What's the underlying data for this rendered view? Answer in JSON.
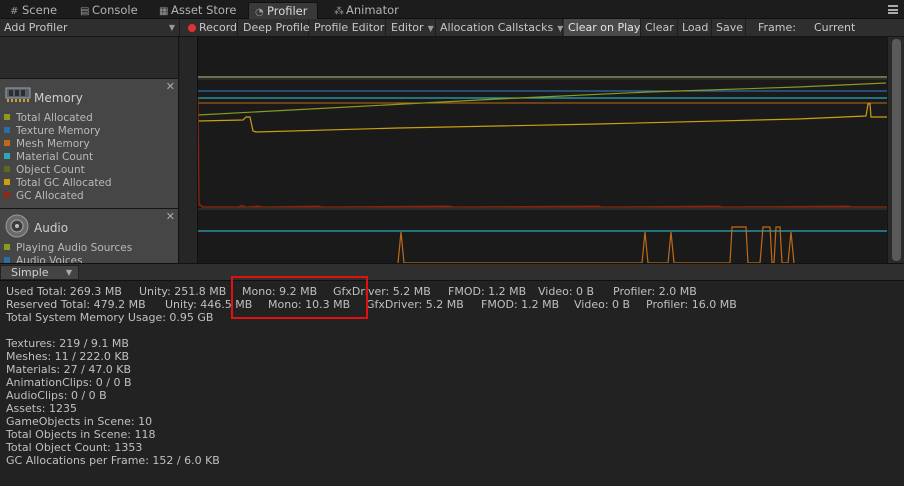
{
  "tabs": [
    {
      "label": "Scene",
      "icon": "grid-icon",
      "active": false
    },
    {
      "label": "Console",
      "icon": "console-icon",
      "active": false
    },
    {
      "label": "Asset Store",
      "icon": "store-icon",
      "active": false
    },
    {
      "label": "Profiler",
      "icon": "profiler-icon",
      "active": true
    },
    {
      "label": "Animator",
      "icon": "animator-icon",
      "active": false
    }
  ],
  "toolbar": {
    "add_profiler": "Add Profiler",
    "record": "Record",
    "deep_profile": "Deep Profile",
    "profile_editor": "Profile Editor",
    "editor": "Editor",
    "allocation_callstacks": "Allocation Callstacks",
    "clear_on_play": "Clear on Play",
    "clear": "Clear",
    "load": "Load",
    "save": "Save",
    "frame_label": "Frame:",
    "frame_value": "Current"
  },
  "memory_module": {
    "title": "Memory",
    "legend": [
      {
        "label": "Total Allocated",
        "color": "#8a9a1c"
      },
      {
        "label": "Texture Memory",
        "color": "#2c6fa6"
      },
      {
        "label": "Mesh Memory",
        "color": "#c06a18"
      },
      {
        "label": "Material Count",
        "color": "#2fa7b5"
      },
      {
        "label": "Object Count",
        "color": "#5c6a1a"
      },
      {
        "label": "Total GC Allocated",
        "color": "#c9a010"
      },
      {
        "label": "GC Allocated",
        "color": "#8c2a12"
      }
    ]
  },
  "audio_module": {
    "title": "Audio",
    "legend": [
      {
        "label": "Playing Audio Sources",
        "color": "#8a9a1c"
      },
      {
        "label": "Audio Voices",
        "color": "#2c6fa6"
      }
    ]
  },
  "details": {
    "mode": "Simple"
  },
  "stats": {
    "used": [
      "Used Total: 269.3 MB",
      "Unity: 251.8 MB",
      "Mono: 9.2 MB",
      "GfxDriver: 5.2 MB",
      "FMOD: 1.2 MB",
      "Video: 0 B",
      "Profiler: 2.0 MB"
    ],
    "reserved": [
      "Reserved Total: 479.2 MB",
      "Unity: 446.5 MB",
      "Mono: 10.3 MB",
      "GfxDriver: 5.2 MB",
      "FMOD: 1.2 MB",
      "Video: 0 B",
      "Profiler: 16.0 MB"
    ],
    "system": "Total System Memory Usage: 0.95 GB",
    "objects": [
      "Textures: 219 / 9.1 MB",
      "Meshes: 11 / 222.0 KB",
      "Materials: 27 / 47.0 KB",
      "AnimationClips: 0 / 0 B",
      "AudioClips: 0 / 0 B",
      "Assets: 1235",
      "GameObjects in Scene: 10",
      "Total Objects in Scene: 118",
      "Total Object Count: 1353",
      "GC Allocations per Frame: 152 / 6.0 KB"
    ]
  }
}
